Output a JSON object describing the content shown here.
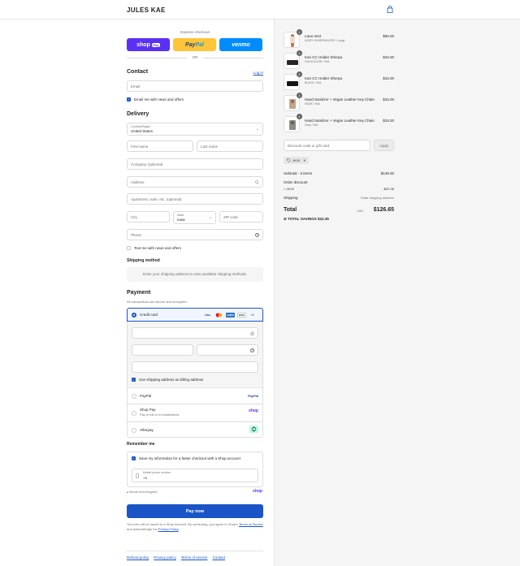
{
  "header": {
    "brand": "JULES KAE",
    "cart_icon": "shopping-bag-icon"
  },
  "express": {
    "title": "Express checkout",
    "shop_label": "shop",
    "shop_badge": "Pay",
    "paypal_a": "Pay",
    "paypal_b": "Pal",
    "venmo_label": "venmo",
    "or_label": "OR"
  },
  "contact": {
    "title": "Contact",
    "login_link": "Log in",
    "email_placeholder": "Email",
    "news_label": "Email me with news and offers"
  },
  "delivery": {
    "title": "Delivery",
    "country_label": "Country/Region",
    "country_value": "United States",
    "first_name": "First name",
    "last_name": "Last name",
    "company": "Company (optional)",
    "address": "Address",
    "apartment": "Apartment, suite, etc. (optional)",
    "city": "City",
    "state_label": "State",
    "state_value": "Iowa",
    "zip": "ZIP code",
    "phone": "Phone",
    "text_label": "Text me with news and offers"
  },
  "shipping": {
    "title": "Shipping method",
    "info": "Enter your shipping address to view available shipping methods."
  },
  "payment": {
    "title": "Payment",
    "subtitle": "All transactions are secure and encrypted.",
    "credit_card": "Credit card",
    "card_logos": [
      "VISA",
      "MC",
      "AMEX",
      "DISC"
    ],
    "more_cards": "+4",
    "billing_label": "Use shipping address as billing address",
    "paypal": "PayPal",
    "paypal_logo": "PayPal",
    "shop_pay": "Shop Pay",
    "shop_pay_sub": "Pay in full or in installments",
    "shop_logo": "shop",
    "afterpay": "Afterpay"
  },
  "remember": {
    "title": "Remember me",
    "save_label": "Save my information for a faster checkout with a Shop account",
    "mobile_label": "Mobile phone number",
    "mobile_value": "+1",
    "secure": "Secure and encrypted",
    "shop_logo": "shop"
  },
  "pay_now": "Pay now",
  "legal": {
    "text1": "Your info will be saved to a Shop account. By continuing, you agree to Shop's",
    "terms": "Terms of Service",
    "text2": " and acknowledge the ",
    "privacy": "Privacy Policy",
    "end": "."
  },
  "footer": [
    "Refund policy",
    "Privacy policy",
    "Terms of service",
    "Contact"
  ],
  "cart": {
    "items": [
      {
        "qty": "1",
        "name": "Lana Vest",
        "variant": "IVORY SHERPA/IVORY / Large",
        "price": "$69.00"
      },
      {
        "qty": "1",
        "name": "Kari CC Holder Sherpa",
        "variant": "CHOCOLATE / N/A",
        "price": "$15.00"
      },
      {
        "qty": "1",
        "name": "Kari CC Holder Sherpa",
        "variant": "BLACK / N/A",
        "price": "$15.00"
      },
      {
        "qty": "1",
        "name": "Hand Sanitizer + Vegan Leather Key Chain",
        "variant": "NUDE / N/A",
        "price": "$15.00"
      },
      {
        "qty": "1",
        "name": "Hand Sanitizer + Vegan Leather Key Chain",
        "variant": "Grey / N/A",
        "price": "$15.00"
      }
    ],
    "discount_placeholder": "Discount code or gift card",
    "apply": "Apply",
    "code_chip": "JK15",
    "subtotal_label": "Subtotal · 5 items",
    "subtotal": "$149.00",
    "order_discount": "Order discount",
    "discount_code": "JK15",
    "discount_value": "- $22.35",
    "shipping_label": "Shipping",
    "shipping_value": "Enter shipping address",
    "total_label": "Total",
    "currency": "USD",
    "total": "$126.65",
    "savings_label": "TOTAL SAVINGS",
    "savings": "$22.35"
  },
  "colors": {
    "accent": "#1a55c7",
    "shop_purple": "#5a31f4",
    "paypal_yellow": "#ffc439",
    "venmo_blue": "#008cff"
  }
}
